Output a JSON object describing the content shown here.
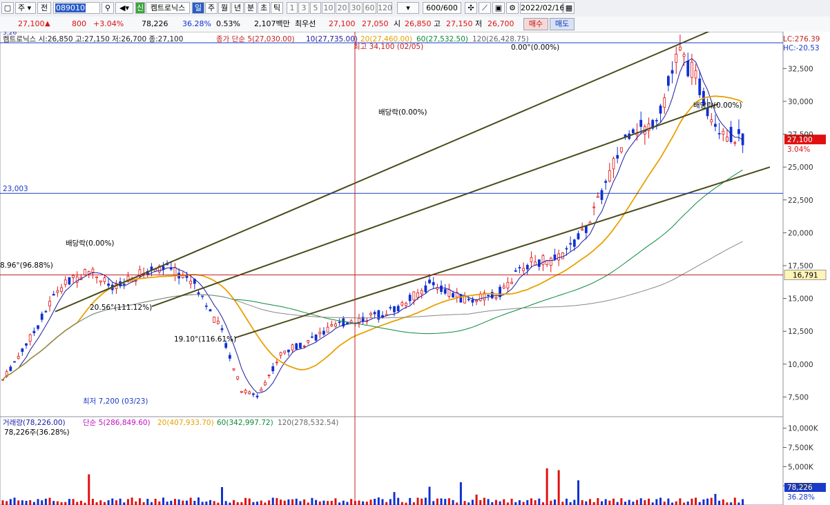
{
  "toolbar": {
    "market_selector": "주",
    "prev_label": "전",
    "stock_code": "089010",
    "stock_badge": "신",
    "stock_name": "켐트로닉스",
    "periods": [
      "일",
      "주",
      "월",
      "년",
      "분",
      "초",
      "틱"
    ],
    "active_period": "일",
    "intervals": [
      "1",
      "3",
      "5",
      "10",
      "20",
      "30",
      "60",
      "120"
    ],
    "count": "600/600",
    "date": "2022/02/16"
  },
  "quote": {
    "price": "27,100",
    "change": "800",
    "change_pct": "+3.04%",
    "volume": "78,226",
    "volume_ratio": "36.28%",
    "turnover_ratio": "0.53%",
    "amount": "2,107백만",
    "best_label": "최우선",
    "best_ask": "27,100",
    "best_bid": "27,050",
    "open_label": "시",
    "open": "26,850",
    "high_label": "고",
    "high": "27,150",
    "low_label": "저",
    "low": "26,700",
    "buy_button": "매수",
    "sell_button": "매도"
  },
  "colors": {
    "up": "#e01010",
    "down": "#1030d0",
    "ma5": "#1a1aa0",
    "ma20": "#e8a000",
    "ma60": "#0a8a3a",
    "ma120": "#888888",
    "channel": "#4a4a1a"
  },
  "chart_data": [
    {
      "type": "candlestick",
      "legend": {
        "name_ohlc": "켐트로닉스 시:26,850 고:27,150 저:26,700 종:27,100",
        "name_tag": "3:26",
        "ma_label": "종가 단순",
        "ma5": "5(27,030.00)",
        "ma10": "10(27,735.00)",
        "ma20": "20(27,460.00)",
        "ma60": "60(27,532.50)",
        "ma120": "120(26,428.75)"
      },
      "y_ticks": [
        "32,500",
        "30,000",
        "27,500",
        "25,000",
        "22,500",
        "20,000",
        "17,500",
        "15,000",
        "12,500",
        "10,000",
        "7,500"
      ],
      "y_tick_values": [
        32500,
        30000,
        27500,
        25000,
        22500,
        20000,
        17500,
        15000,
        12500,
        10000,
        7500
      ],
      "ylim": [
        6000,
        35300
      ],
      "lc_label": "LC:276.39",
      "hc_label": "HC:-20.53",
      "current_price_label": "27,100",
      "current_change_label": "3.04%",
      "ref_line_value": 16791,
      "ref_line_label": "16,791",
      "hline_value": 23003,
      "hline_label": "23,003",
      "annotations": [
        {
          "text": "최고 34,100 (02/05)",
          "price": 34100
        },
        {
          "text": "최저 7,200 (03/23)",
          "price": 7200
        },
        {
          "text": "0.00°(0.00%)"
        },
        {
          "text": "배당락(0.00%)"
        },
        {
          "text": "배당락(0.00%)"
        },
        {
          "text": "배당락(0.00%)"
        },
        {
          "text": "8.96°(96.88%)"
        },
        {
          "text": "20.56°(111.12%)"
        },
        {
          "text": "19.10°(116.61%)"
        }
      ]
    },
    {
      "type": "bar",
      "legend": {
        "title": "거래량(78,226.00)",
        "ma5": "단순 5(286,849.60)",
        "ma20": "20(407,933.70)",
        "ma60": "60(342,997.72)",
        "ma120": "120(278,532.54)",
        "current": "78,226주(36.28%)"
      },
      "y_ticks": [
        "10,000K",
        "7,500K",
        "5,000K",
        "2,500K"
      ],
      "y_tick_values": [
        10000,
        7500,
        5000,
        2500
      ],
      "ylim": [
        0,
        11500
      ],
      "current_volume_label": "78,226",
      "current_ratio_label": "36.28%"
    }
  ]
}
